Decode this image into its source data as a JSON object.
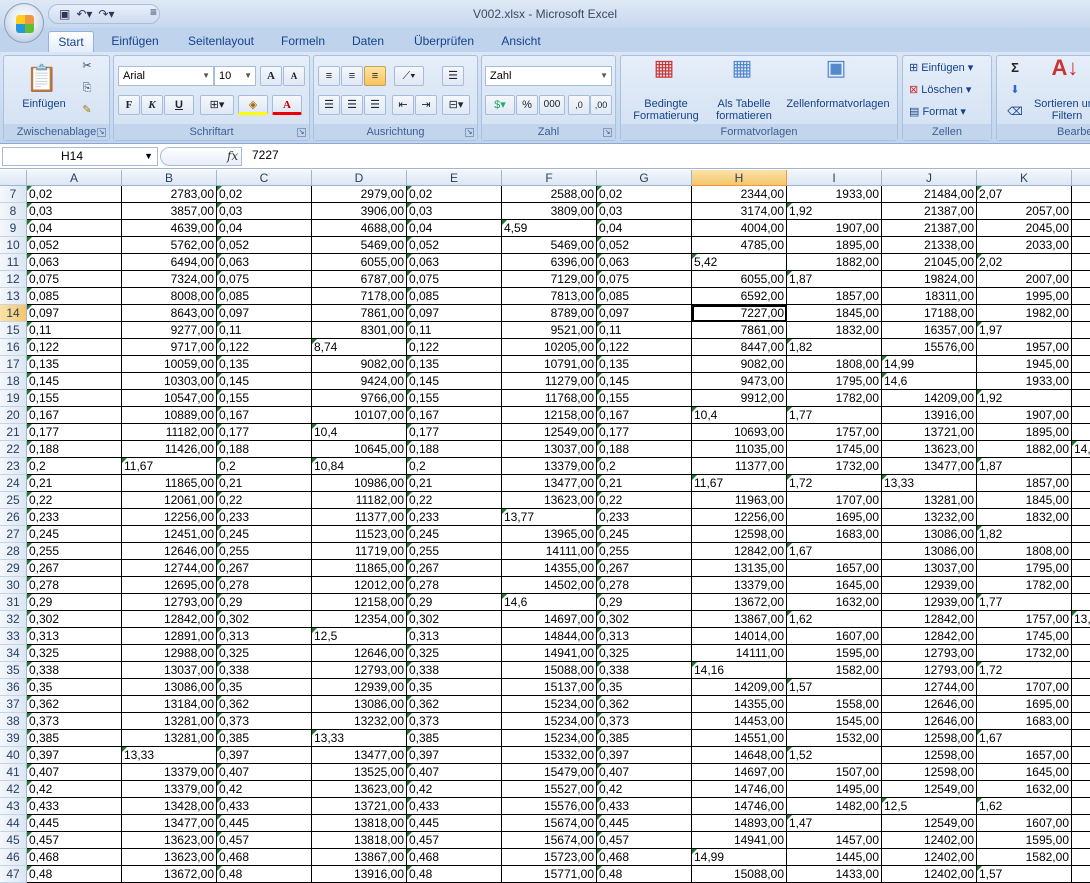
{
  "window": {
    "title": "V002.xlsx - Microsoft Excel",
    "qat_more": "≡"
  },
  "tabs": [
    "Start",
    "Einfügen",
    "Seitenlayout",
    "Formeln",
    "Daten",
    "Überprüfen",
    "Ansicht"
  ],
  "ribbon": {
    "clipboard": {
      "label": "Zwischenablage",
      "paste": "Einfügen"
    },
    "font": {
      "label": "Schriftart",
      "name": "Arial",
      "size": "10",
      "bold": "F",
      "italic": "K",
      "underline": "U",
      "grow": "A",
      "shrink": "A",
      "color": "A"
    },
    "alignment": {
      "label": "Ausrichtung"
    },
    "number": {
      "label": "Zahl",
      "format": "Zahl",
      "percent": "%",
      "thousands": "000",
      "inc": ",0",
      "dec": ",00"
    },
    "styles": {
      "label": "Formatvorlagen",
      "conditional": "Bedingte Formatierung",
      "as_table": "Als Tabelle formatieren",
      "cell_styles": "Zellenformatvorlagen"
    },
    "cells": {
      "label": "Zellen",
      "insert": "Einfügen",
      "delete": "Löschen",
      "format": "Format"
    },
    "editing": {
      "label": "Bearbeiten",
      "sigma": "Σ",
      "sort": "Sortieren und Filtern"
    }
  },
  "formula_bar": {
    "name_box": "H14",
    "fx": "fx",
    "value": "7227"
  },
  "grid": {
    "column_headers": [
      "A",
      "B",
      "C",
      "D",
      "E",
      "F",
      "G",
      "H",
      "I",
      "J",
      "K"
    ],
    "selected_cell": "H14",
    "row_numbers": [
      "7",
      "8",
      "9",
      "10",
      "11",
      "12",
      "13",
      "14",
      "15",
      "16",
      "17",
      "18",
      "19",
      "20",
      "21",
      "22",
      "23",
      "24",
      "25",
      "26",
      "27",
      "28",
      "29",
      "30",
      "31",
      "32",
      "33",
      "34",
      "35",
      "36",
      "37",
      "38",
      "39",
      "40",
      "41",
      "42",
      "43",
      "44",
      "45",
      "46",
      "47"
    ],
    "columns": {
      "A": [
        "0,02",
        "0,03",
        "0,04",
        "0,052",
        "0,063",
        "0,075",
        "0,085",
        "0,097",
        "0,11",
        "0,122",
        "0,135",
        "0,145",
        "0,155",
        "0,167",
        "0,177",
        "0,188",
        "0,2",
        "0,21",
        "0,22",
        "0,233",
        "0,245",
        "0,255",
        "0,267",
        "0,278",
        "0,29",
        "0,302",
        "0,313",
        "0,325",
        "0,338",
        "0,35",
        "0,362",
        "0,373",
        "0,385",
        "0,397",
        "0,407",
        "0,42",
        "0,433",
        "0,445",
        "0,457",
        "0,468",
        "0,48"
      ],
      "B": [
        "2783,00",
        "3857,00",
        "4639,00",
        "5762,00",
        "6494,00",
        "7324,00",
        "8008,00",
        "8643,00",
        "9277,00",
        "9717,00",
        "10059,00",
        "10303,00",
        "10547,00",
        "10889,00",
        "11182,00",
        "11426,00",
        "11,67",
        "11865,00",
        "12061,00",
        "12256,00",
        "12451,00",
        "12646,00",
        "12744,00",
        "12695,00",
        "12793,00",
        "12842,00",
        "12891,00",
        "12988,00",
        "13037,00",
        "13086,00",
        "13184,00",
        "13281,00",
        "13281,00",
        "13,33",
        "13379,00",
        "13379,00",
        "13428,00",
        "13477,00",
        "13623,00",
        "13623,00",
        "13672,00"
      ],
      "C": [
        "0,02",
        "0,03",
        "0,04",
        "0,052",
        "0,063",
        "0,075",
        "0,085",
        "0,097",
        "0,11",
        "0,122",
        "0,135",
        "0,145",
        "0,155",
        "0,167",
        "0,177",
        "0,188",
        "0,2",
        "0,21",
        "0,22",
        "0,233",
        "0,245",
        "0,255",
        "0,267",
        "0,278",
        "0,29",
        "0,302",
        "0,313",
        "0,325",
        "0,338",
        "0,35",
        "0,362",
        "0,373",
        "0,385",
        "0,397",
        "0,407",
        "0,42",
        "0,433",
        "0,445",
        "0,457",
        "0,468",
        "0,48"
      ],
      "D": [
        "2979,00",
        "3906,00",
        "4688,00",
        "5469,00",
        "6055,00",
        "6787,00",
        "7178,00",
        "7861,00",
        "8301,00",
        "8,74",
        "9082,00",
        "9424,00",
        "9766,00",
        "10107,00",
        "10,4",
        "10645,00",
        "10,84",
        "10986,00",
        "11182,00",
        "11377,00",
        "11523,00",
        "11719,00",
        "11865,00",
        "12012,00",
        "12158,00",
        "12354,00",
        "12,5",
        "12646,00",
        "12793,00",
        "12939,00",
        "13086,00",
        "13232,00",
        "13,33",
        "13477,00",
        "13525,00",
        "13623,00",
        "13721,00",
        "13818,00",
        "13818,00",
        "13867,00",
        "13916,00"
      ],
      "E": [
        "0,02",
        "0,03",
        "0,04",
        "0,052",
        "0,063",
        "0,075",
        "0,085",
        "0,097",
        "0,11",
        "0,122",
        "0,135",
        "0,145",
        "0,155",
        "0,167",
        "0,177",
        "0,188",
        "0,2",
        "0,21",
        "0,22",
        "0,233",
        "0,245",
        "0,255",
        "0,267",
        "0,278",
        "0,29",
        "0,302",
        "0,313",
        "0,325",
        "0,338",
        "0,35",
        "0,362",
        "0,373",
        "0,385",
        "0,397",
        "0,407",
        "0,42",
        "0,433",
        "0,445",
        "0,457",
        "0,468",
        "0,48"
      ],
      "F": [
        "2588,00",
        "3809,00",
        "4,59",
        "5469,00",
        "6396,00",
        "7129,00",
        "7813,00",
        "8789,00",
        "9521,00",
        "10205,00",
        "10791,00",
        "11279,00",
        "11768,00",
        "12158,00",
        "12549,00",
        "13037,00",
        "13379,00",
        "13477,00",
        "13623,00",
        "13,77",
        "13965,00",
        "14111,00",
        "14355,00",
        "14502,00",
        "14,6",
        "14697,00",
        "14844,00",
        "14941,00",
        "15088,00",
        "15137,00",
        "15234,00",
        "15234,00",
        "15234,00",
        "15332,00",
        "15479,00",
        "15527,00",
        "15576,00",
        "15674,00",
        "15674,00",
        "15723,00",
        "15771,00"
      ],
      "G": [
        "0,02",
        "0,03",
        "0,04",
        "0,052",
        "0,063",
        "0,075",
        "0,085",
        "0,097",
        "0,11",
        "0,122",
        "0,135",
        "0,145",
        "0,155",
        "0,167",
        "0,177",
        "0,188",
        "0,2",
        "0,21",
        "0,22",
        "0,233",
        "0,245",
        "0,255",
        "0,267",
        "0,278",
        "0,29",
        "0,302",
        "0,313",
        "0,325",
        "0,338",
        "0,35",
        "0,362",
        "0,373",
        "0,385",
        "0,397",
        "0,407",
        "0,42",
        "0,433",
        "0,445",
        "0,457",
        "0,468",
        "0,48"
      ],
      "H": [
        "2344,00",
        "3174,00",
        "4004,00",
        "4785,00",
        "5,42",
        "6055,00",
        "6592,00",
        "7227,00",
        "7861,00",
        "8447,00",
        "9082,00",
        "9473,00",
        "9912,00",
        "10,4",
        "10693,00",
        "11035,00",
        "11377,00",
        "11,67",
        "11963,00",
        "12256,00",
        "12598,00",
        "12842,00",
        "13135,00",
        "13379,00",
        "13672,00",
        "13867,00",
        "14014,00",
        "14111,00",
        "14,16",
        "14209,00",
        "14355,00",
        "14453,00",
        "14551,00",
        "14648,00",
        "14697,00",
        "14746,00",
        "14746,00",
        "14893,00",
        "14941,00",
        "14,99",
        "15088,00"
      ],
      "I": [
        "1933,00",
        "1,92",
        "1907,00",
        "1895,00",
        "1882,00",
        "1,87",
        "1857,00",
        "1845,00",
        "1832,00",
        "1,82",
        "1808,00",
        "1795,00",
        "1782,00",
        "1,77",
        "1757,00",
        "1745,00",
        "1732,00",
        "1,72",
        "1707,00",
        "1695,00",
        "1683,00",
        "1,67",
        "1657,00",
        "1645,00",
        "1632,00",
        "1,62",
        "1607,00",
        "1595,00",
        "1582,00",
        "1,57",
        "1558,00",
        "1545,00",
        "1532,00",
        "1,52",
        "1507,00",
        "1495,00",
        "1482,00",
        "1,47",
        "1457,00",
        "1445,00",
        "1433,00"
      ],
      "J": [
        "21484,00",
        "21387,00",
        "21387,00",
        "21338,00",
        "21045,00",
        "19824,00",
        "18311,00",
        "17188,00",
        "16357,00",
        "15576,00",
        "14,99",
        "14,6",
        "14209,00",
        "13916,00",
        "13721,00",
        "13623,00",
        "13477,00",
        "13,33",
        "13281,00",
        "13232,00",
        "13086,00",
        "13086,00",
        "13037,00",
        "12939,00",
        "12939,00",
        "12842,00",
        "12842,00",
        "12793,00",
        "12793,00",
        "12744,00",
        "12646,00",
        "12646,00",
        "12598,00",
        "12598,00",
        "12598,00",
        "12549,00",
        "12,5",
        "12549,00",
        "12402,00",
        "12402,00",
        "12402,00"
      ],
      "K": [
        "2,07",
        "2057,00",
        "2045,00",
        "2033,00",
        "2,02",
        "2007,00",
        "1995,00",
        "1982,00",
        "1,97",
        "1957,00",
        "1945,00",
        "1933,00",
        "1,92",
        "1907,00",
        "1895,00",
        "1882,00",
        "1,87",
        "1857,00",
        "1845,00",
        "1832,00",
        "1,82",
        "1808,00",
        "1795,00",
        "1782,00",
        "1,77",
        "1757,00",
        "1745,00",
        "1732,00",
        "1,72",
        "1707,00",
        "1695,00",
        "1683,00",
        "1,67",
        "1657,00",
        "1645,00",
        "1632,00",
        "1,62",
        "1607,00",
        "1595,00",
        "1582,00",
        "1,57"
      ],
      "L": [
        "",
        "",
        "",
        "",
        "",
        "",
        "",
        "",
        "",
        "",
        "",
        "",
        "",
        "",
        "",
        "14,",
        "",
        "",
        "",
        "",
        "",
        "",
        "",
        "",
        "",
        "13,",
        "",
        "",
        "",
        "",
        "",
        "",
        "",
        "",
        "",
        "",
        "",
        "",
        "",
        "",
        ""
      ]
    }
  }
}
